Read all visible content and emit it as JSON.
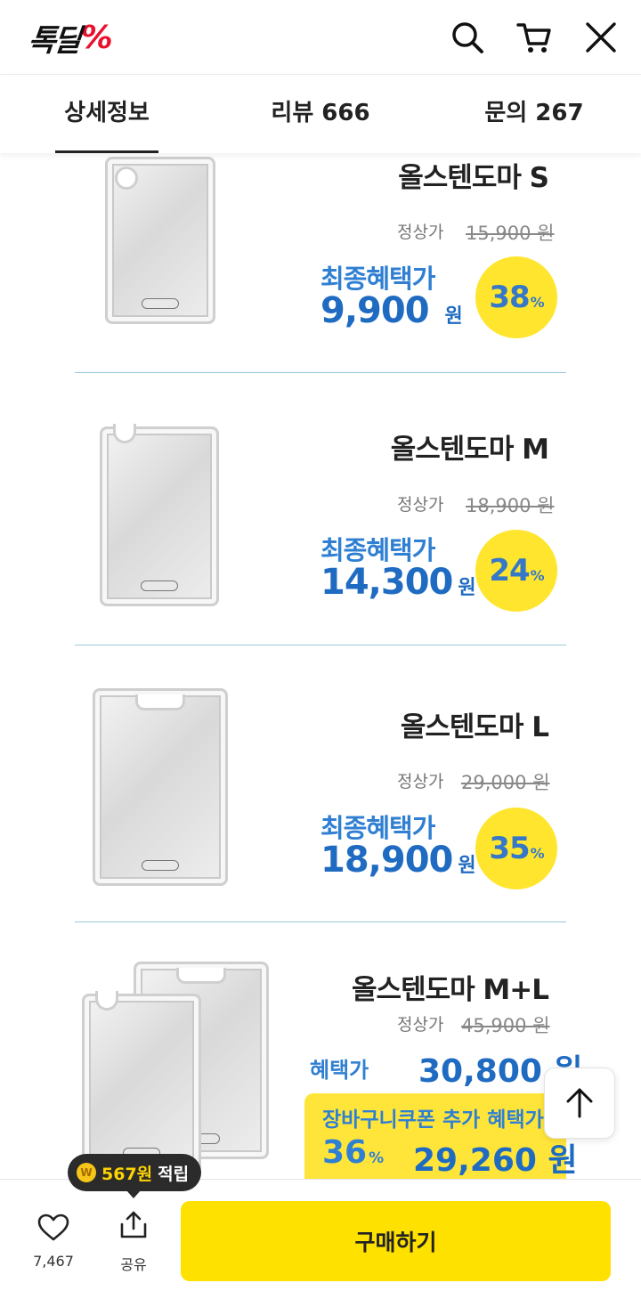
{
  "header": {
    "logo_text": "톡딜",
    "logo_symbol": "%",
    "brand_color": "#e8112d",
    "icons": [
      "search-icon",
      "cart-icon",
      "close-icon"
    ]
  },
  "tabs": [
    {
      "label": "상세정보",
      "active": true
    },
    {
      "label": "리뷰 666",
      "active": false
    },
    {
      "label": "문의 267",
      "active": false
    }
  ],
  "products": [
    {
      "name": "올스텐도마 S",
      "orig_label": "정상가",
      "orig_price": "15,900 원",
      "final_label": "최종혜택가",
      "final_price": "9,900",
      "won": "원",
      "discount": "38",
      "pct": "%"
    },
    {
      "name": "올스텐도마 M",
      "orig_label": "정상가",
      "orig_price": "18,900 원",
      "final_label": "최종혜택가",
      "final_price": "14,300",
      "won": "원",
      "discount": "24",
      "pct": "%"
    },
    {
      "name": "올스텐도마 L",
      "orig_label": "정상가",
      "orig_price": "29,000 원",
      "final_label": "최종혜택가",
      "final_price": "18,900",
      "won": "원",
      "discount": "35",
      "pct": "%"
    },
    {
      "name": "올스텐도마 M+L",
      "orig_label": "정상가",
      "orig_price": "45,900 원",
      "benefit_label": "혜택가",
      "benefit_price": "30,800 원",
      "coupon_title": "장바구니쿠폰 추가 혜택가",
      "coupon_discount": "36",
      "pct": "%",
      "coupon_price": "29,260 원"
    }
  ],
  "points": {
    "coin": "W",
    "amount": "567원",
    "label": "적립"
  },
  "bottom_bar": {
    "like_count": "7,467",
    "share_label": "공유",
    "buy_label": "구매하기"
  },
  "colors": {
    "accent_blue": "#1f6bc1",
    "badge_yellow": "#ffe52e",
    "buy_yellow": "#ffe100"
  }
}
